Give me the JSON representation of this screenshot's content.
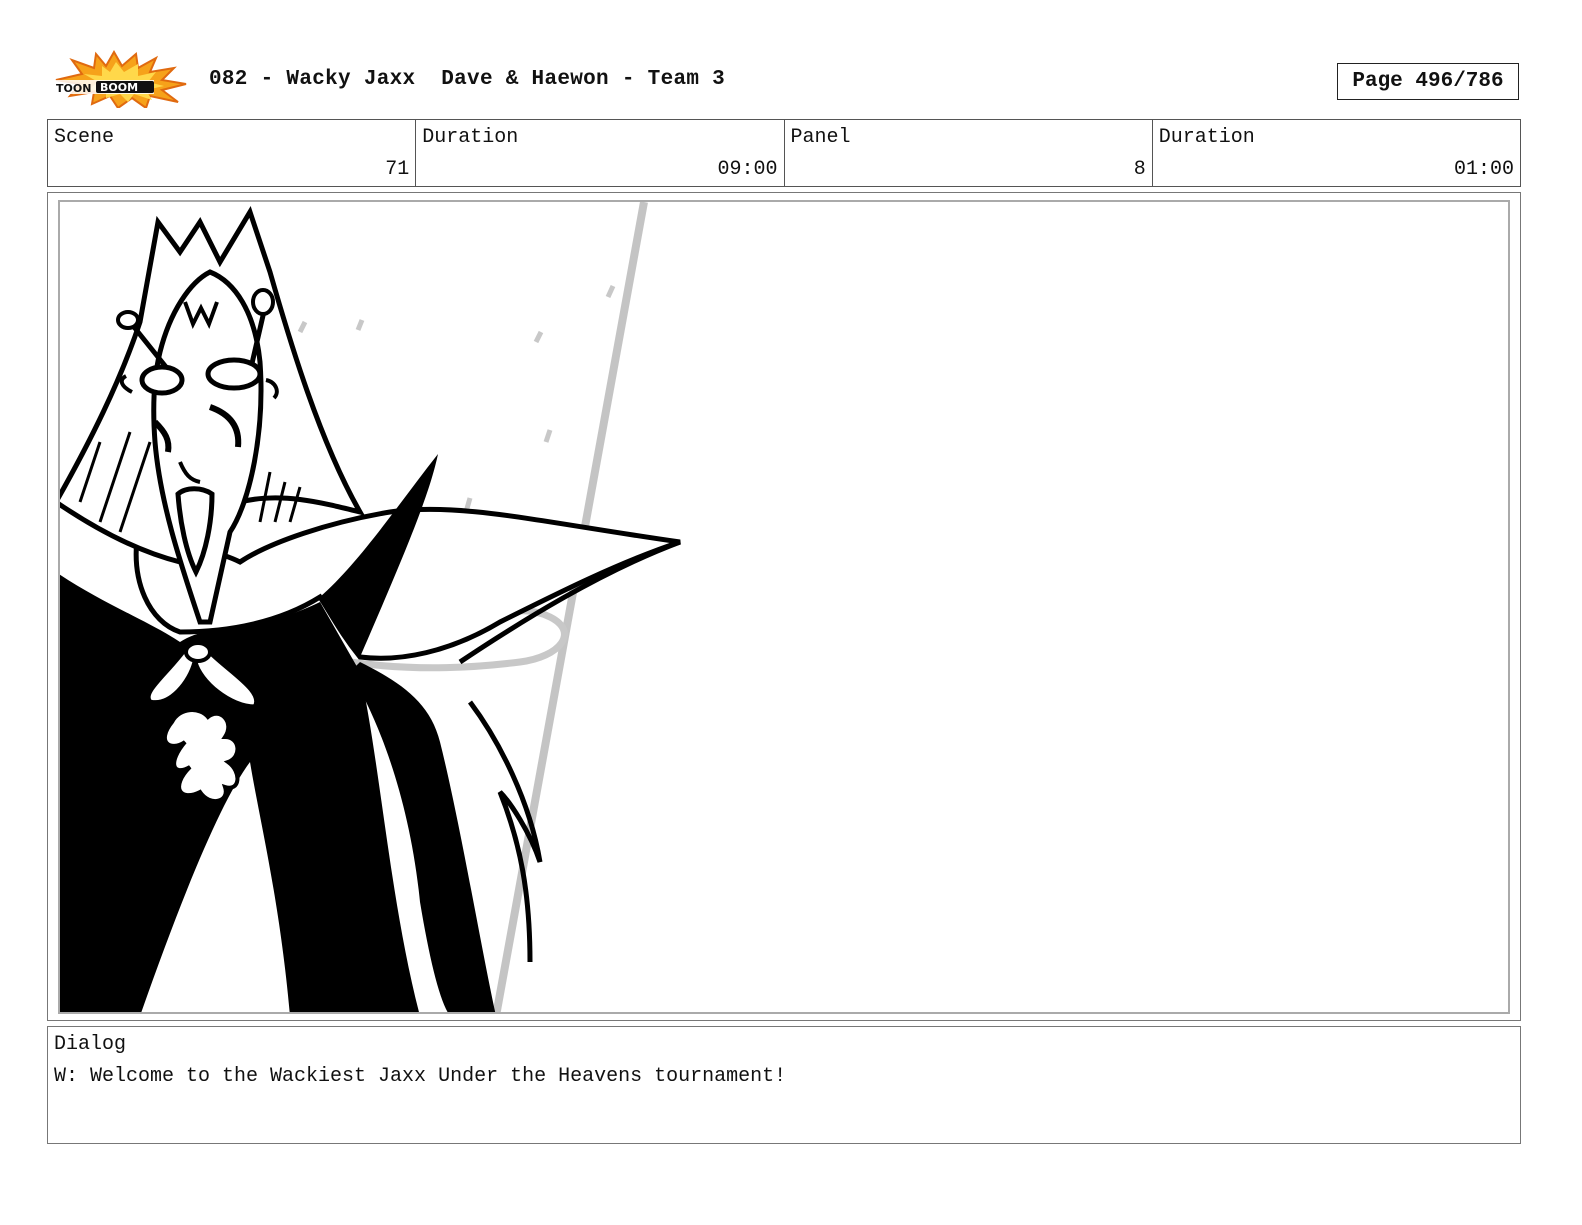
{
  "header": {
    "logo_text": "TOONBOOM",
    "project_title": "082 - Wacky Jaxx  Dave & Haewon - Team 3",
    "page_label": "Page 496/786"
  },
  "info": {
    "scene_label": "Scene",
    "scene_value": "71",
    "scene_duration_label": "Duration",
    "scene_duration_value": "09:00",
    "panel_label": "Panel",
    "panel_value": "8",
    "panel_duration_label": "Duration",
    "panel_duration_value": "01:00"
  },
  "dialog": {
    "label": "Dialog",
    "text": "W: Welcome to the Wackiest Jaxx Under the Heavens tournament!"
  }
}
